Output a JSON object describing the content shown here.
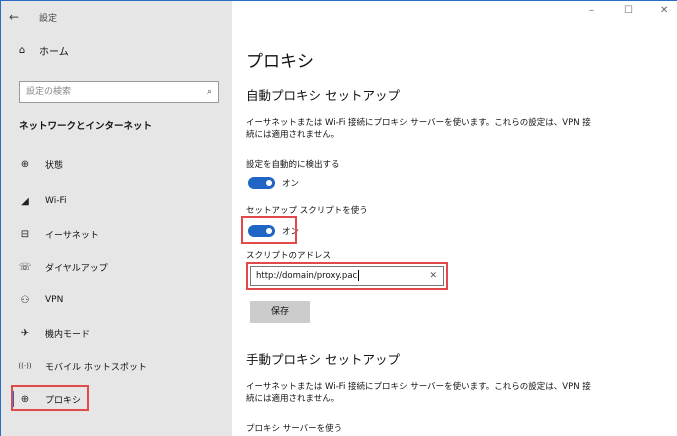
{
  "window": {
    "title": "設定",
    "back_icon": "←",
    "controls": {
      "minimize": "–",
      "maximize": "☐",
      "close": "✕"
    }
  },
  "sidebar": {
    "home": {
      "icon": "⌂",
      "label": "ホーム"
    },
    "search": {
      "placeholder": "設定の検索",
      "icon": "⌕"
    },
    "section": "ネットワークとインターネット",
    "items": [
      {
        "icon": "⊕",
        "icon_name": "status-globe-icon",
        "label": "状態"
      },
      {
        "icon": "◢",
        "icon_name": "wifi-icon",
        "label": "Wi-Fi"
      },
      {
        "icon": "⊟",
        "icon_name": "ethernet-icon",
        "label": "イーサネット"
      },
      {
        "icon": "☏",
        "icon_name": "dialup-icon",
        "label": "ダイヤルアップ"
      },
      {
        "icon": "⚇",
        "icon_name": "vpn-icon",
        "label": "VPN"
      },
      {
        "icon": "✈",
        "icon_name": "airplane-icon",
        "label": "機内モード"
      },
      {
        "icon": "((·))",
        "icon_name": "hotspot-icon",
        "label": "モバイル ホットスポット"
      },
      {
        "icon": "⊕",
        "icon_name": "proxy-globe-icon",
        "label": "プロキシ",
        "selected": true
      }
    ]
  },
  "main": {
    "title": "プロキシ",
    "auto": {
      "heading": "自動プロキシ セットアップ",
      "description": "イーサネットまたは Wi-Fi 接続にプロキシ サーバーを使います。これらの設定は、VPN 接続には適用されません。",
      "detect_label": "設定を自動的に検出する",
      "detect_state": "オン",
      "script_label": "セットアップ スクリプトを使う",
      "script_state": "オン",
      "address_label": "スクリプトのアドレス",
      "address_value": "http://domain/proxy.pac",
      "clear_icon": "✕",
      "save_label": "保存"
    },
    "manual": {
      "heading": "手動プロキシ セットアップ",
      "description": "イーサネットまたは Wi-Fi 接続にプロキシ サーバーを使います。これらの設定は、VPN 接続には適用されません。",
      "use_proxy_label": "プロキシ サーバーを使う"
    }
  },
  "colors": {
    "accent": "#1f66c7",
    "highlight_box": "#e14a4a",
    "sidebar_bg": "#e6e6e6"
  }
}
